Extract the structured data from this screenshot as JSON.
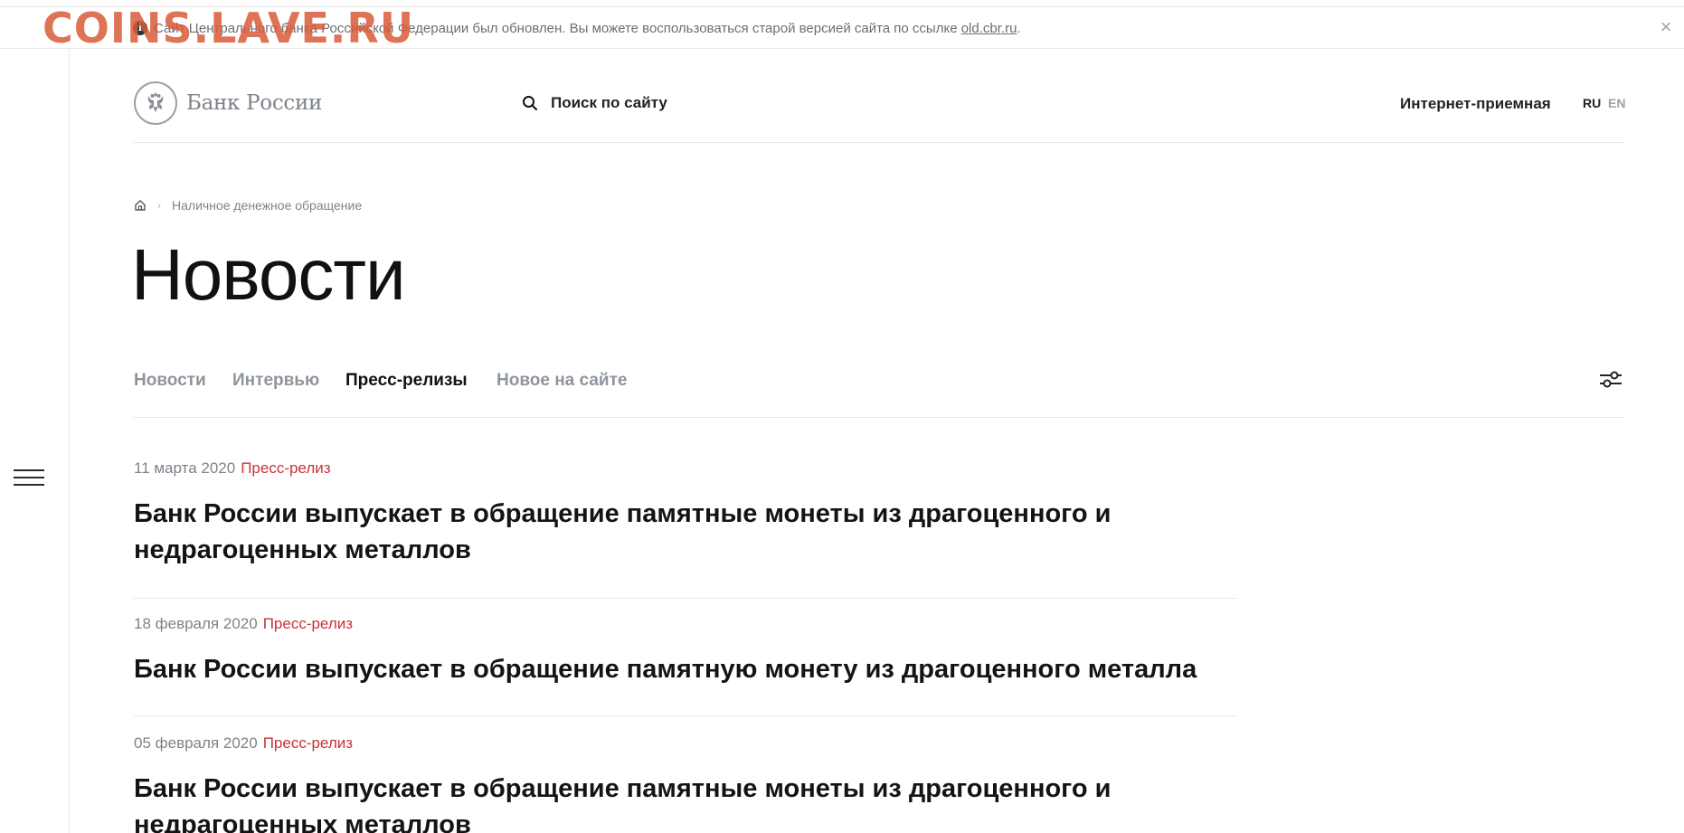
{
  "notice": {
    "message": "Сайт Центрального банка Российской Федерации был обновлен. Вы можете воспользоваться старой версией сайта по ссылке ",
    "link_text": "old.cbr.ru",
    "link_suffix": ".",
    "close_icon": "close-icon"
  },
  "watermark": "COINS.LAVE.RU",
  "header": {
    "logo_text": "Банк России",
    "search_label": "Поиск по сайту",
    "reception": "Интернет-приемная",
    "lang_ru": "RU",
    "lang_en": "EN"
  },
  "breadcrumb": {
    "items": [
      "Наличное денежное обращение"
    ]
  },
  "page_title": "Новости",
  "tabs": [
    {
      "label": "Новости",
      "active": false
    },
    {
      "label": "Интервью",
      "active": false
    },
    {
      "label": "Пресс-релизы",
      "active": true
    },
    {
      "label": "Новое на сайте",
      "active": false
    }
  ],
  "news": [
    {
      "date": "11 марта 2020",
      "type": "Пресс-релиз",
      "title": "Банк России выпускает в обращение памятные монеты из драгоценного и недрагоценных металлов"
    },
    {
      "date": "18 февраля 2020",
      "type": "Пресс-релиз",
      "title": "Банк России выпускает в обращение памятную монету из драгоценного металла"
    },
    {
      "date": "05 февраля 2020",
      "type": "Пресс-релиз",
      "title": "Банк России выпускает в обращение памятные монеты из драгоценного и недрагоценных металлов"
    }
  ],
  "colors": {
    "accent_red": "#c8323a",
    "muted_gray": "#8e959c",
    "text_dark": "#111111"
  }
}
